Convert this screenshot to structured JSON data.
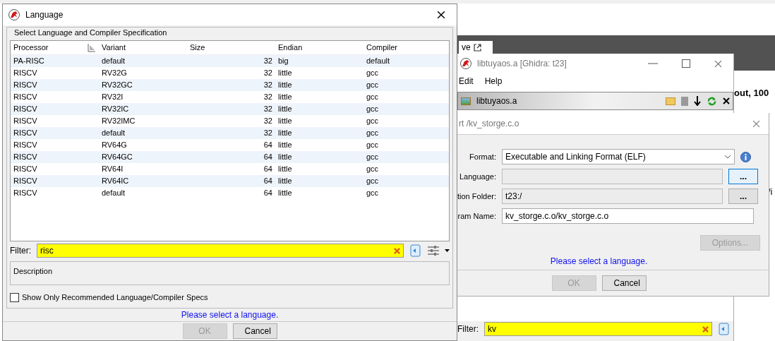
{
  "background_page": {
    "tab_label": "ve",
    "side_text": "out, 100",
    "edge_text": "/i"
  },
  "main_window": {
    "title": "libtuyaos.a [Ghidra: t23]",
    "menu": [
      "Edit",
      "Help"
    ],
    "tree_title": "libtuyaos.a",
    "filter": {
      "label": "Filter:",
      "value": "kv"
    }
  },
  "import_dialog": {
    "title": "rt /kv_storge.c.o",
    "fields": [
      {
        "label": "Format:",
        "kind": "dropdown",
        "value": "Executable and Linking Format (ELF)"
      },
      {
        "label": "Language:",
        "kind": "browse",
        "button": "...",
        "focused": true
      },
      {
        "label": "tion Folder:",
        "kind": "browse",
        "value": "t23:/",
        "button": "...",
        "focused": false
      },
      {
        "label": "ram Name:",
        "kind": "text",
        "value": "kv_storge.c.o/kv_storge.c.o"
      }
    ],
    "options_button": {
      "label": "Options...",
      "disabled": true
    },
    "status": "Please select a language.",
    "buttons": [
      {
        "label": "OK",
        "disabled": true
      },
      {
        "label": "Cancel",
        "disabled": false
      }
    ]
  },
  "language_dialog": {
    "title": "Language",
    "group_title": "Select Language and Compiler Specification",
    "table": {
      "columns": [
        "Processor",
        "Variant",
        "Size",
        "Endian",
        "Compiler"
      ],
      "rows": [
        {
          "processor": "PA-RISC",
          "variant": "default",
          "size": "32",
          "endian": "big",
          "compiler": "default"
        },
        {
          "processor": "RISCV",
          "variant": "RV32G",
          "size": "32",
          "endian": "little",
          "compiler": "gcc"
        },
        {
          "processor": "RISCV",
          "variant": "RV32GC",
          "size": "32",
          "endian": "little",
          "compiler": "gcc"
        },
        {
          "processor": "RISCV",
          "variant": "RV32I",
          "size": "32",
          "endian": "little",
          "compiler": "gcc"
        },
        {
          "processor": "RISCV",
          "variant": "RV32IC",
          "size": "32",
          "endian": "little",
          "compiler": "gcc"
        },
        {
          "processor": "RISCV",
          "variant": "RV32IMC",
          "size": "32",
          "endian": "little",
          "compiler": "gcc"
        },
        {
          "processor": "RISCV",
          "variant": "default",
          "size": "32",
          "endian": "little",
          "compiler": "gcc"
        },
        {
          "processor": "RISCV",
          "variant": "RV64G",
          "size": "64",
          "endian": "little",
          "compiler": "gcc"
        },
        {
          "processor": "RISCV",
          "variant": "RV64GC",
          "size": "64",
          "endian": "little",
          "compiler": "gcc"
        },
        {
          "processor": "RISCV",
          "variant": "RV64I",
          "size": "64",
          "endian": "little",
          "compiler": "gcc"
        },
        {
          "processor": "RISCV",
          "variant": "RV64IC",
          "size": "64",
          "endian": "little",
          "compiler": "gcc"
        },
        {
          "processor": "RISCV",
          "variant": "default",
          "size": "64",
          "endian": "little",
          "compiler": "gcc"
        }
      ]
    },
    "filter": {
      "label": "Filter:",
      "value": "risc"
    },
    "description_title": "Description",
    "recommended_checkbox": {
      "label": "Show Only Recommended Language/Compiler Specs",
      "checked": false
    },
    "status": "Please select a language.",
    "buttons": [
      {
        "label": "OK",
        "disabled": true
      },
      {
        "label": "Cancel",
        "disabled": false
      }
    ]
  }
}
